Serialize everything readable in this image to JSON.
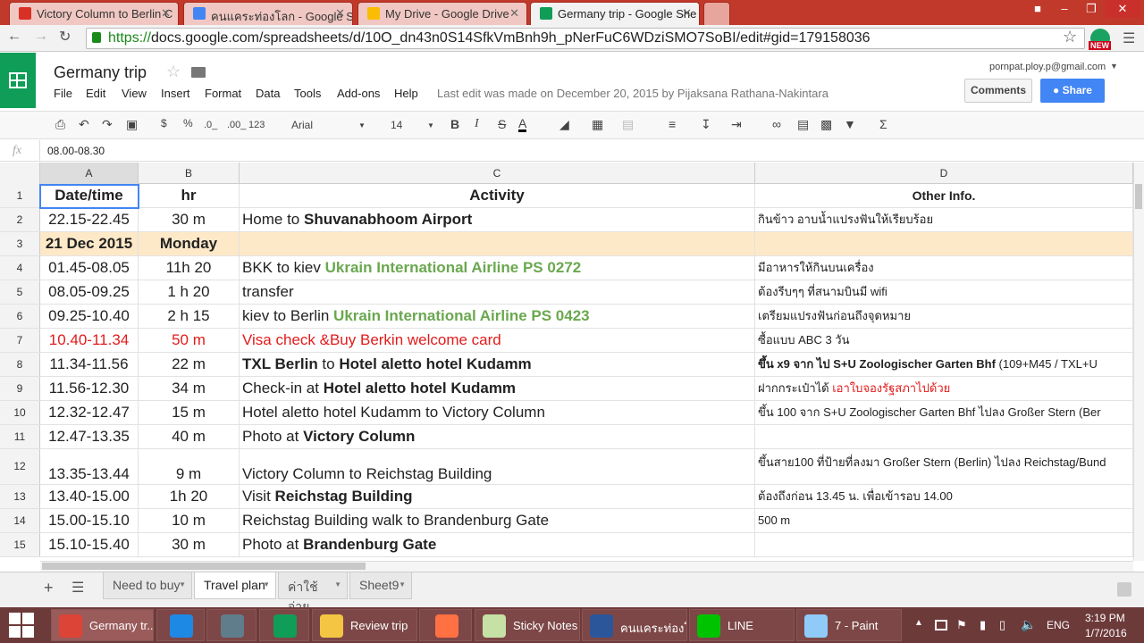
{
  "browser": {
    "tabs": [
      {
        "title": "Victory Column to Berlin C",
        "color": "#d93025"
      },
      {
        "title": "คนแคระท่องโลก - Google Se",
        "color": "#4285f4"
      },
      {
        "title": "My Drive - Google Drive",
        "color": "#fbbc04"
      },
      {
        "title": "Germany trip - Google She",
        "color": "#0f9d58"
      }
    ],
    "url_scheme": "https://",
    "url_rest": "docs.google.com/spreadsheets/d/10O_dn43n0S14SfkVmBnh9h_pNerFuC6WDziSMO7SoBI/edit#gid=179158036",
    "ext_badge": "NEW"
  },
  "doc": {
    "title": "Germany trip",
    "account": "pornpat.ploy.p@gmail.com",
    "menus": [
      "File",
      "Edit",
      "View",
      "Insert",
      "Format",
      "Data",
      "Tools",
      "Add-ons",
      "Help"
    ],
    "last_edit": "Last edit was made on December 20, 2015 by Pijaksana Rathana-Nakintara",
    "comments_label": "Comments",
    "share_label": "Share"
  },
  "toolbar": {
    "currency": "$",
    "percent": "%",
    "dec_less": ".0_",
    "dec_more": ".00_",
    "format_more": "123",
    "font": "Arial",
    "font_size": "14",
    "bold": "B",
    "italic": "I",
    "strike": "S",
    "textcolor": "A"
  },
  "formula": {
    "fx": "fx",
    "value": "08.00-08.30"
  },
  "columns": [
    "A",
    "B",
    "C",
    "D"
  ],
  "rows": [
    {
      "n": "1",
      "a": "Date/time",
      "b": "hr",
      "c": [
        {
          "t": "Activity",
          "s": "b"
        }
      ],
      "d": [
        {
          "t": "Other Info.",
          "s": "b"
        }
      ],
      "header": true
    },
    {
      "n": "2",
      "a": "22.15-22.45",
      "b": "30 m",
      "c": [
        {
          "t": "Home to ",
          "s": ""
        },
        {
          "t": "Shuvanabhoom Airport",
          "s": "b"
        }
      ],
      "d": [
        {
          "t": "กินข้าว อาบน้ำแปรงฟันให้เรียบร้อย",
          "s": ""
        }
      ]
    },
    {
      "n": "3",
      "a": "21 Dec 2015",
      "b": "Monday",
      "c": [],
      "d": [],
      "day": true
    },
    {
      "n": "4",
      "a": "01.45-08.05",
      "b": "11h 20",
      "c": [
        {
          "t": "BKK to kiev ",
          "s": ""
        },
        {
          "t": "Ukrain International Airline PS 0272",
          "s": "green"
        }
      ],
      "d": [
        {
          "t": "มีอาหารให้กินบนเครื่อง",
          "s": ""
        }
      ]
    },
    {
      "n": "5",
      "a": "08.05-09.25",
      "b": "1 h 20",
      "c": [
        {
          "t": "transfer",
          "s": ""
        }
      ],
      "d": [
        {
          "t": "ต้องรีบๆๆ ที่สนามบินมี wifi",
          "s": ""
        }
      ]
    },
    {
      "n": "6",
      "a": "09.25-10.40",
      "b": "2 h 15",
      "c": [
        {
          "t": "kiev to Berlin ",
          "s": ""
        },
        {
          "t": "Ukrain International Airline PS 0423",
          "s": "green"
        }
      ],
      "d": [
        {
          "t": "เตรียมแปรงฟันก่อนถึงจุดหมาย",
          "s": ""
        }
      ]
    },
    {
      "n": "7",
      "a": "10.40-11.34",
      "b": "50 m",
      "c": [
        {
          "t": "Visa check &Buy Berkin welcome card",
          "s": "red"
        }
      ],
      "d": [
        {
          "t": "ซื้อแบบ ABC 3 วัน",
          "s": ""
        }
      ],
      "red": true
    },
    {
      "n": "8",
      "a": "11.34-11.56",
      "b": "22 m",
      "c": [
        {
          "t": "TXL Berlin",
          "s": "b"
        },
        {
          "t": " to ",
          "s": ""
        },
        {
          "t": "Hotel aletto hotel Kudamm",
          "s": "b"
        }
      ],
      "d": [
        {
          "t": "ขึ้น x9 จาก ไป S+U Zoologischer Garten Bhf",
          "s": "b"
        },
        {
          "t": " (109+M45 / TXL+U",
          "s": ""
        }
      ]
    },
    {
      "n": "9",
      "a": "11.56-12.30",
      "b": "34 m",
      "c": [
        {
          "t": "Check-in at ",
          "s": ""
        },
        {
          "t": "Hotel aletto hotel Kudamm",
          "s": "b"
        }
      ],
      "d": [
        {
          "t": "ฝากกระเป๋าได้ ",
          "s": ""
        },
        {
          "t": "เอาใบจองรัฐสภาไปด้วย",
          "s": "red"
        }
      ]
    },
    {
      "n": "10",
      "a": "12.32-12.47",
      "b": "15 m",
      "c": [
        {
          "t": "Hotel aletto hotel Kudamm to Victory Column",
          "s": ""
        }
      ],
      "d": [
        {
          "t": "ขึ้น 100 จาก S+U Zoologischer Garten Bhf ไปลง Großer Stern (Ber",
          "s": ""
        }
      ]
    },
    {
      "n": "11",
      "a": "12.47-13.35",
      "b": "40 m",
      "c": [
        {
          "t": "Photo at ",
          "s": ""
        },
        {
          "t": "Victory Column",
          "s": "b"
        }
      ],
      "d": []
    },
    {
      "n": "12",
      "a": "13.35-13.44",
      "b": "9 m",
      "c": [
        {
          "t": "Victory Column to Reichstag Building",
          "s": ""
        }
      ],
      "d": [
        {
          "t": "ขึ้นสาย100 ที่ป้ายที่ลงมา Großer Stern (Berlin) ไปลง Reichstag/Bund",
          "s": ""
        }
      ],
      "tall": true
    },
    {
      "n": "13",
      "a": "13.40-15.00",
      "b": "1h 20",
      "c": [
        {
          "t": "Visit ",
          "s": ""
        },
        {
          "t": "Reichstag Building",
          "s": "b"
        }
      ],
      "d": [
        {
          "t": "ต้องถึงก่อน 13.45 น. เพื่อเข้ารอบ 14.00",
          "s": ""
        }
      ]
    },
    {
      "n": "14",
      "a": "15.00-15.10",
      "b": "10 m",
      "c": [
        {
          "t": "Reichstag Building walk to Brandenburg Gate",
          "s": ""
        }
      ],
      "d": [
        {
          "t": "500 m",
          "s": ""
        }
      ]
    },
    {
      "n": "15",
      "a": "15.10-15.40",
      "b": "30 m",
      "c": [
        {
          "t": "Photo at ",
          "s": ""
        },
        {
          "t": "Brandenburg Gate",
          "s": "b"
        }
      ],
      "d": []
    }
  ],
  "sheets": [
    {
      "label": "Need to buy",
      "active": false
    },
    {
      "label": "Travel plan",
      "active": true
    },
    {
      "label": "ค่าใช้จ่าย",
      "active": false
    },
    {
      "label": "Sheet9",
      "active": false
    }
  ],
  "taskbar": {
    "apps": [
      {
        "label": "Germany tr...",
        "color": "#db4437"
      },
      {
        "label": "",
        "color": "#1e88e5"
      },
      {
        "label": "",
        "color": "#607d8b"
      },
      {
        "label": "",
        "color": "#0f9d58"
      },
      {
        "label": "Review trip",
        "color": "#f4c542"
      },
      {
        "label": "",
        "color": "#ff7043"
      },
      {
        "label": "Sticky Notes",
        "color": "#c5e1a5"
      },
      {
        "label": "คนแคระท่องโ...",
        "color": "#2b579a"
      },
      {
        "label": "LINE",
        "color": "#00c300"
      },
      {
        "label": "7 - Paint",
        "color": "#90caf9"
      }
    ],
    "lang": "ENG",
    "time": "3:19 PM",
    "date": "1/7/2016"
  }
}
